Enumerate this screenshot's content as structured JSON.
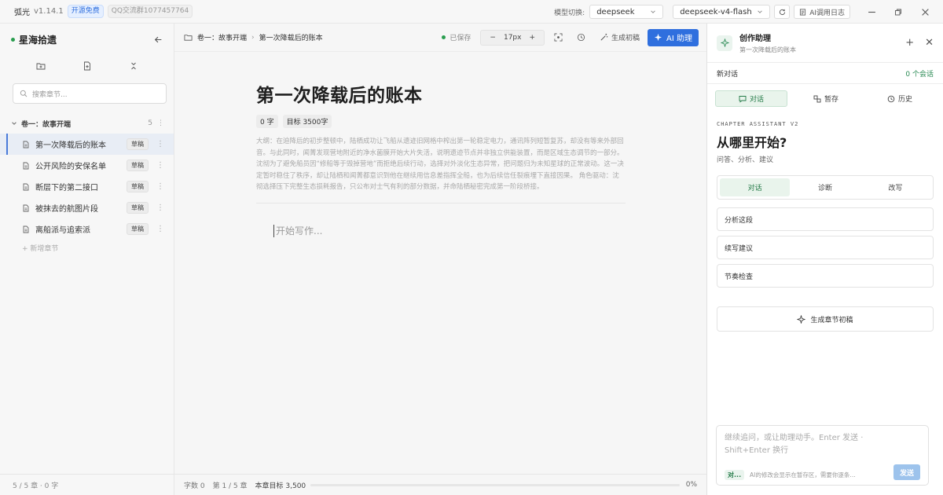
{
  "titlebar": {
    "app_name": "弧光",
    "version": "v1.14.1",
    "badge_free": "开源免费",
    "badge_qq": "QQ交流群1077457764",
    "model_label": "模型切换:",
    "provider": "deepseek",
    "model": "deepseek-v4-flash",
    "log_button": "AI调用日志"
  },
  "sidebar": {
    "project": "星海拾遗",
    "search_placeholder": "搜索章节...",
    "volume": {
      "title": "卷一：故事开端",
      "count": "5"
    },
    "chapters": [
      {
        "title": "第一次降载后的账本",
        "status": "草稿"
      },
      {
        "title": "公开风险的安保名单",
        "status": "草稿"
      },
      {
        "title": "断层下的第二接口",
        "status": "草稿"
      },
      {
        "title": "被抹去的航图片段",
        "status": "草稿"
      },
      {
        "title": "离船派与追索派",
        "status": "草稿"
      }
    ],
    "add_chapter": "+ 新增章节",
    "footer": "5 / 5 章 · 0 字"
  },
  "editor": {
    "breadcrumb_volume": "卷一：故事开端",
    "breadcrumb_chapter": "第一次降载后的账本",
    "saved": "已保存",
    "font_size": "17px",
    "generate_draft": "生成初稿",
    "ai_assist": "AI 助理",
    "title": "第一次降载后的账本",
    "word_count": "0 字",
    "target": "目标 3500字",
    "outline": "大纲：在迫降后的初步整顿中，陆栖成功让飞船从遗迹旧网格中榨出第一轮稳定电力，通讯阵列短暂复苏，却没有等来外部回音。与此同时，闻菁发现营地附近的净水菌膜开始大片失活，说明遗迹节点并非独立供能装置，而是区域生态调节的一部分。沈彻为了避免船员因“修船等于毁掉营地”而拒绝后续行动，选择对外淡化生态异常，把问题归为未知星球的正常波动。这一决定暂时稳住了秩序，却让陆栖和闻菁都意识到他在继续用信息差指挥全船，也为后续信任裂痕埋下直接因果。 角色驱动：沈彻选择压下完整生态损耗报告，只公布对士气有利的部分数据，并命陆栖秘密完成第一阶段桥接。",
    "placeholder": "开始写作...",
    "footer": {
      "words": "字数 0",
      "chapter_pos": "第 1 / 5 章",
      "chapter_target": "本章目标 3,500",
      "progress_label": "0%",
      "progress": 0
    }
  },
  "panel": {
    "title": "创作助理",
    "subtitle": "第一次降载后的账本",
    "new_chat": "新对话",
    "session_count": "0 个会话",
    "tabs": [
      "对话",
      "暂存",
      "历史"
    ],
    "eyebrow": "CHAPTER ASSISTANT V2",
    "heading": "从哪里开始?",
    "sub": "问答、分析、建议",
    "segments": [
      "对话",
      "诊断",
      "改写"
    ],
    "quick_actions": [
      "分析这段",
      "续写建议",
      "节奏检查"
    ],
    "generate": "生成章节初稿",
    "input_placeholder": "继续追问，或让助理动手。Enter 发送 · Shift+Enter 换行",
    "mode": "对...",
    "hint": "AI的修改会显示在暂存区，需要你逐条确...",
    "send": "发送"
  },
  "colors": {
    "accent_blue": "#2f6fde",
    "accent_green": "#237a47",
    "saved_dot": "#2a9d4f"
  }
}
